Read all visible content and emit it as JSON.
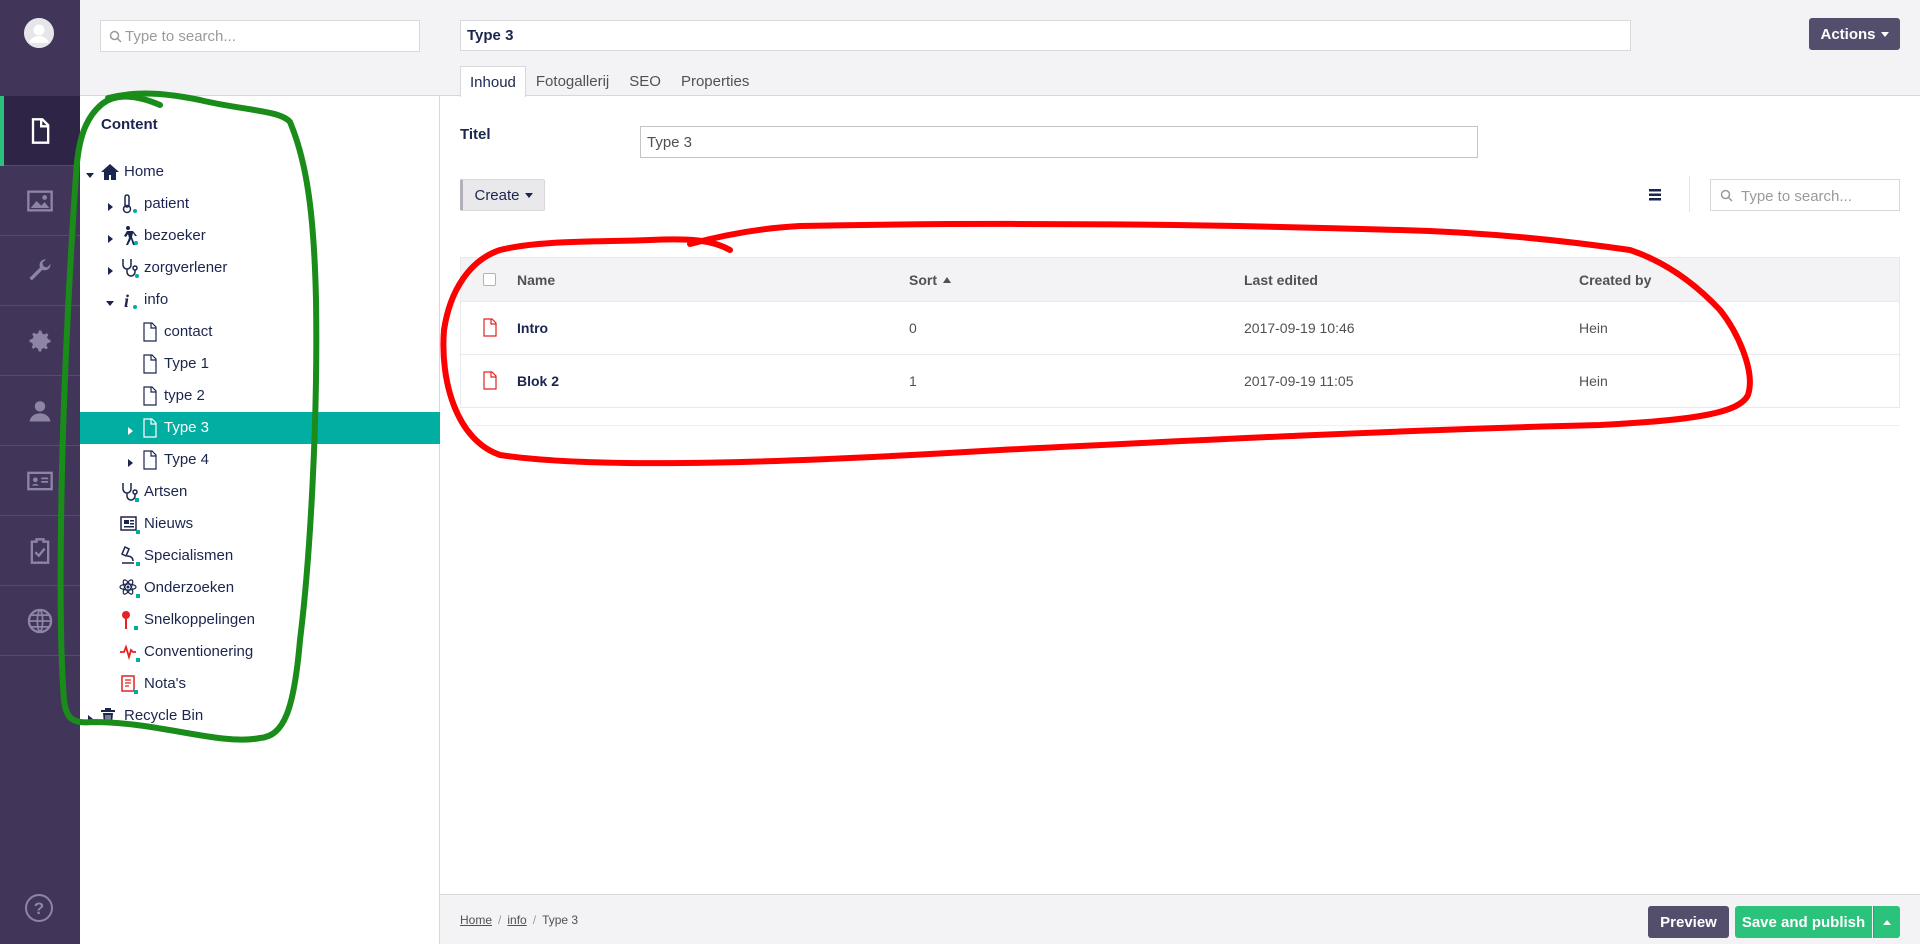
{
  "tree": {
    "search_placeholder": "Type to search...",
    "heading": "Content",
    "nodes": [
      {
        "label": "Home"
      },
      {
        "label": "patient"
      },
      {
        "label": "bezoeker"
      },
      {
        "label": "zorgverlener"
      },
      {
        "label": "info"
      },
      {
        "label": "contact"
      },
      {
        "label": "Type 1"
      },
      {
        "label": "type 2"
      },
      {
        "label": "Type 3"
      },
      {
        "label": "Type 4"
      },
      {
        "label": "Artsen"
      },
      {
        "label": "Nieuws"
      },
      {
        "label": "Specialismen"
      },
      {
        "label": "Onderzoeken"
      },
      {
        "label": "Snelkoppelingen"
      },
      {
        "label": "Conventionering"
      },
      {
        "label": "Nota's"
      },
      {
        "label": "Recycle Bin"
      }
    ]
  },
  "editor": {
    "name_value": "Type 3",
    "actions_label": "Actions",
    "tabs": [
      {
        "label": "Inhoud"
      },
      {
        "label": "Fotogallerij"
      },
      {
        "label": "SEO"
      },
      {
        "label": "Properties"
      }
    ],
    "titel_label": "Titel",
    "titel_value": "Type 3",
    "create_label": "Create",
    "search_placeholder": "Type to search..."
  },
  "list": {
    "columns": {
      "name": "Name",
      "sort": "Sort",
      "last_edited": "Last edited",
      "created_by": "Created by"
    },
    "rows": [
      {
        "name": "Intro",
        "sort": "0",
        "last_edited": "2017-09-19 10:46",
        "created_by": "Hein"
      },
      {
        "name": "Blok 2",
        "sort": "1",
        "last_edited": "2017-09-19 11:05",
        "created_by": "Hein"
      }
    ]
  },
  "footer": {
    "breadcrumb": [
      "Home",
      "info",
      "Type 3"
    ],
    "preview_label": "Preview",
    "publish_label": "Save and publish"
  },
  "colors": {
    "rail": "#413659",
    "selected": "#00aea2",
    "publish": "#2bc37c",
    "annotation_green": "#1a8c1a",
    "annotation_red": "#ff0000"
  }
}
